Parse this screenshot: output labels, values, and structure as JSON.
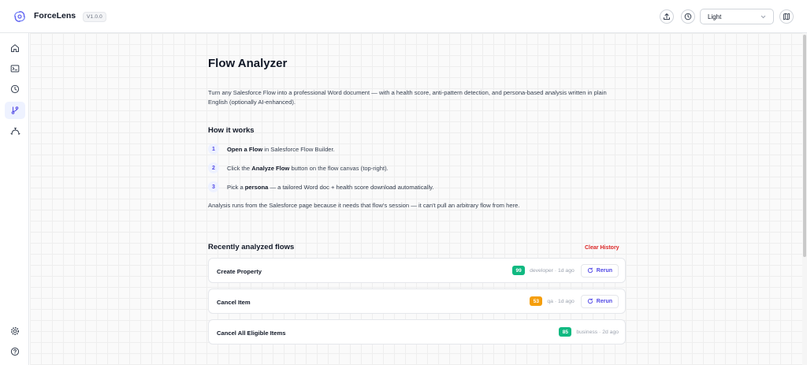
{
  "app": {
    "name": "ForceLens",
    "version": "V1.0.0"
  },
  "header": {
    "theme_select": "Light"
  },
  "sidebar": {
    "active": "flows"
  },
  "main": {
    "title": "Flow Analyzer",
    "intro": "Turn any Salesforce Flow into a professional Word document — with a health score, anti-pattern detection, and persona-based analysis written in plain English (optionally AI-enhanced).",
    "how_title": "How it works",
    "steps": [
      {
        "num": "1",
        "bold": "Open a Flow",
        "pre": "",
        "post": " in Salesforce Flow Builder."
      },
      {
        "num": "2",
        "pre": "Click the ",
        "bold": "Analyze Flow",
        "post": " button on the flow canvas (top-right)."
      },
      {
        "num": "3",
        "pre": "Pick a ",
        "bold": "persona",
        "post": " — a tailored Word doc + health score download automatically."
      }
    ],
    "note": "Analysis runs from the Salesforce page because it needs that flow's session — it can't pull an arbitrary flow from here.",
    "recent_title": "Recently analyzed flows",
    "clear_history": "Clear History",
    "rerun_label": "Rerun",
    "flows": [
      {
        "name": "Create Property",
        "score": "99",
        "score_color": "#10b981",
        "meta": "developer · 1d ago",
        "rerun": true
      },
      {
        "name": "Cancel Item",
        "score": "53",
        "score_color": "#f59e0b",
        "meta": "qa · 1d ago",
        "rerun": true
      },
      {
        "name": "Cancel All Eligible Items",
        "score": "85",
        "score_color": "#10b981",
        "meta": "business · 2d ago",
        "rerun": false
      }
    ]
  },
  "colors": {
    "accent": "#4f46e5",
    "danger": "#dc2626",
    "good": "#10b981",
    "warn": "#f59e0b"
  }
}
